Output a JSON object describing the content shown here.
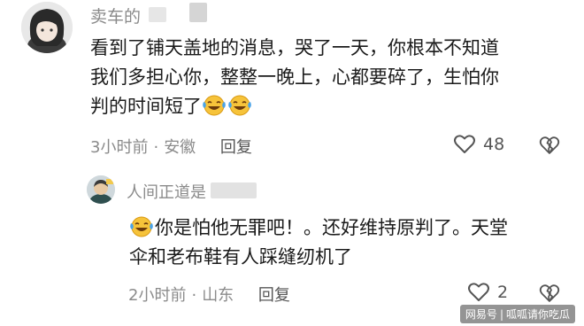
{
  "comments": [
    {
      "username": "卖车的",
      "text_line1": "看到了铺天盖地的消息，哭了一天，你根本不知道",
      "text_line2": "我们多担心你，整整一晚上，心都要碎了，生怕你",
      "text_line3": "判的时间短了",
      "time": "3小时前",
      "location": "安徽",
      "reply_label": "回复",
      "likes": "48"
    },
    {
      "username": "人间正道是",
      "text_line1": "你是怕他无罪吧！。还好维持原判了。天堂",
      "text_line2": "伞和老布鞋有人踩缝纫机了",
      "time": "2小时前",
      "location": "山东",
      "reply_label": "回复",
      "likes": "2"
    }
  ],
  "meta_separator": "·",
  "watermark": {
    "source": "网易号",
    "author": "呱呱请你吃瓜"
  },
  "icons": {
    "like": "heart-outline-icon",
    "dislike": "broken-heart-icon",
    "emoji": "laughing-tears-emoji-icon"
  }
}
